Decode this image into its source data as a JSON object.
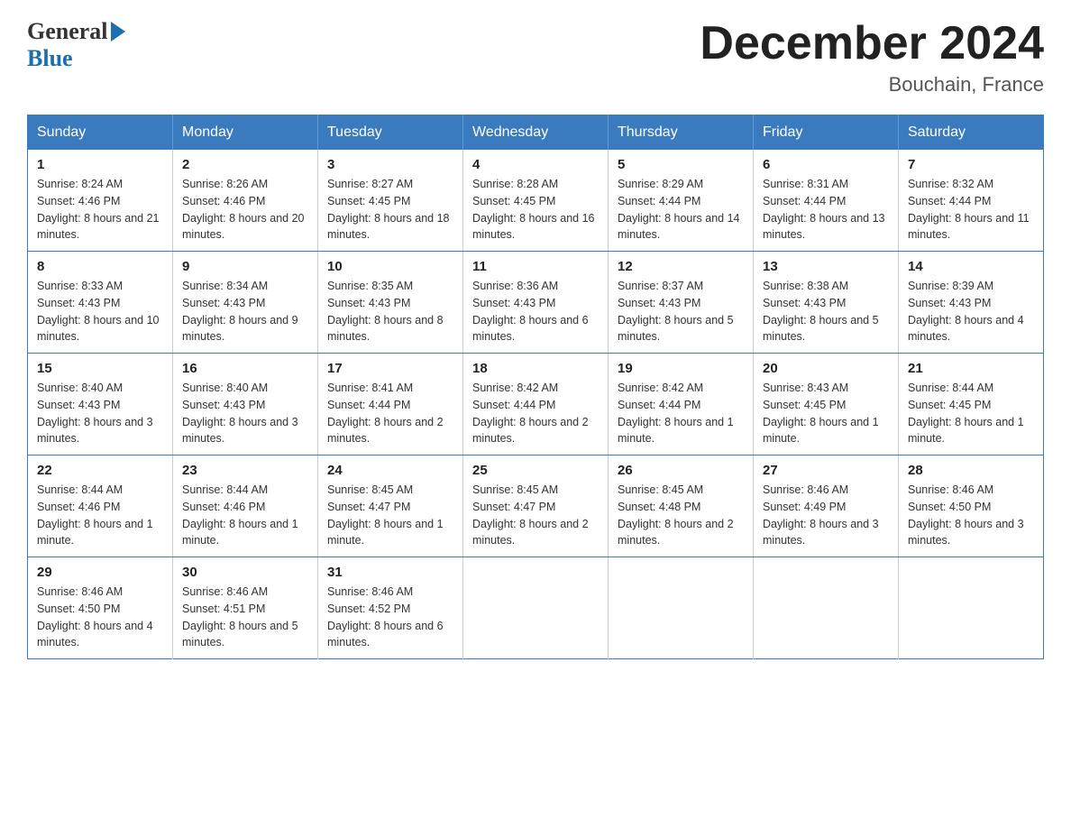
{
  "header": {
    "logo_general": "General",
    "logo_blue": "Blue",
    "month_title": "December 2024",
    "location": "Bouchain, France"
  },
  "weekdays": [
    "Sunday",
    "Monday",
    "Tuesday",
    "Wednesday",
    "Thursday",
    "Friday",
    "Saturday"
  ],
  "weeks": [
    [
      {
        "day": "1",
        "sunrise": "8:24 AM",
        "sunset": "4:46 PM",
        "daylight": "8 hours and 21 minutes."
      },
      {
        "day": "2",
        "sunrise": "8:26 AM",
        "sunset": "4:46 PM",
        "daylight": "8 hours and 20 minutes."
      },
      {
        "day": "3",
        "sunrise": "8:27 AM",
        "sunset": "4:45 PM",
        "daylight": "8 hours and 18 minutes."
      },
      {
        "day": "4",
        "sunrise": "8:28 AM",
        "sunset": "4:45 PM",
        "daylight": "8 hours and 16 minutes."
      },
      {
        "day": "5",
        "sunrise": "8:29 AM",
        "sunset": "4:44 PM",
        "daylight": "8 hours and 14 minutes."
      },
      {
        "day": "6",
        "sunrise": "8:31 AM",
        "sunset": "4:44 PM",
        "daylight": "8 hours and 13 minutes."
      },
      {
        "day": "7",
        "sunrise": "8:32 AM",
        "sunset": "4:44 PM",
        "daylight": "8 hours and 11 minutes."
      }
    ],
    [
      {
        "day": "8",
        "sunrise": "8:33 AM",
        "sunset": "4:43 PM",
        "daylight": "8 hours and 10 minutes."
      },
      {
        "day": "9",
        "sunrise": "8:34 AM",
        "sunset": "4:43 PM",
        "daylight": "8 hours and 9 minutes."
      },
      {
        "day": "10",
        "sunrise": "8:35 AM",
        "sunset": "4:43 PM",
        "daylight": "8 hours and 8 minutes."
      },
      {
        "day": "11",
        "sunrise": "8:36 AM",
        "sunset": "4:43 PM",
        "daylight": "8 hours and 6 minutes."
      },
      {
        "day": "12",
        "sunrise": "8:37 AM",
        "sunset": "4:43 PM",
        "daylight": "8 hours and 5 minutes."
      },
      {
        "day": "13",
        "sunrise": "8:38 AM",
        "sunset": "4:43 PM",
        "daylight": "8 hours and 5 minutes."
      },
      {
        "day": "14",
        "sunrise": "8:39 AM",
        "sunset": "4:43 PM",
        "daylight": "8 hours and 4 minutes."
      }
    ],
    [
      {
        "day": "15",
        "sunrise": "8:40 AM",
        "sunset": "4:43 PM",
        "daylight": "8 hours and 3 minutes."
      },
      {
        "day": "16",
        "sunrise": "8:40 AM",
        "sunset": "4:43 PM",
        "daylight": "8 hours and 3 minutes."
      },
      {
        "day": "17",
        "sunrise": "8:41 AM",
        "sunset": "4:44 PM",
        "daylight": "8 hours and 2 minutes."
      },
      {
        "day": "18",
        "sunrise": "8:42 AM",
        "sunset": "4:44 PM",
        "daylight": "8 hours and 2 minutes."
      },
      {
        "day": "19",
        "sunrise": "8:42 AM",
        "sunset": "4:44 PM",
        "daylight": "8 hours and 1 minute."
      },
      {
        "day": "20",
        "sunrise": "8:43 AM",
        "sunset": "4:45 PM",
        "daylight": "8 hours and 1 minute."
      },
      {
        "day": "21",
        "sunrise": "8:44 AM",
        "sunset": "4:45 PM",
        "daylight": "8 hours and 1 minute."
      }
    ],
    [
      {
        "day": "22",
        "sunrise": "8:44 AM",
        "sunset": "4:46 PM",
        "daylight": "8 hours and 1 minute."
      },
      {
        "day": "23",
        "sunrise": "8:44 AM",
        "sunset": "4:46 PM",
        "daylight": "8 hours and 1 minute."
      },
      {
        "day": "24",
        "sunrise": "8:45 AM",
        "sunset": "4:47 PM",
        "daylight": "8 hours and 1 minute."
      },
      {
        "day": "25",
        "sunrise": "8:45 AM",
        "sunset": "4:47 PM",
        "daylight": "8 hours and 2 minutes."
      },
      {
        "day": "26",
        "sunrise": "8:45 AM",
        "sunset": "4:48 PM",
        "daylight": "8 hours and 2 minutes."
      },
      {
        "day": "27",
        "sunrise": "8:46 AM",
        "sunset": "4:49 PM",
        "daylight": "8 hours and 3 minutes."
      },
      {
        "day": "28",
        "sunrise": "8:46 AM",
        "sunset": "4:50 PM",
        "daylight": "8 hours and 3 minutes."
      }
    ],
    [
      {
        "day": "29",
        "sunrise": "8:46 AM",
        "sunset": "4:50 PM",
        "daylight": "8 hours and 4 minutes."
      },
      {
        "day": "30",
        "sunrise": "8:46 AM",
        "sunset": "4:51 PM",
        "daylight": "8 hours and 5 minutes."
      },
      {
        "day": "31",
        "sunrise": "8:46 AM",
        "sunset": "4:52 PM",
        "daylight": "8 hours and 6 minutes."
      },
      null,
      null,
      null,
      null
    ]
  ],
  "labels": {
    "sunrise_prefix": "Sunrise: ",
    "sunset_prefix": "Sunset: ",
    "daylight_prefix": "Daylight: "
  }
}
